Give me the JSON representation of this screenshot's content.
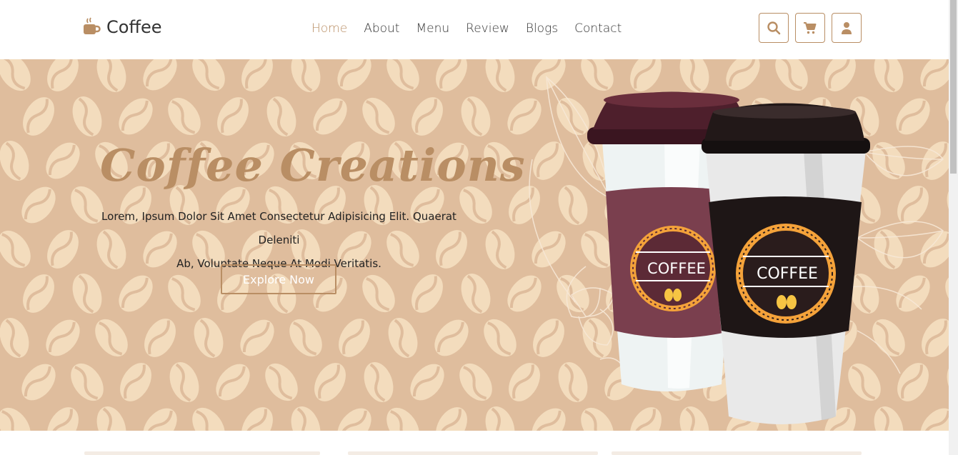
{
  "brand": {
    "logo_icon": "coffee-cup-icon",
    "name": "Coffee"
  },
  "nav": {
    "items": [
      {
        "label": "Home",
        "active": true
      },
      {
        "label": "About",
        "active": false
      },
      {
        "label": "Menu",
        "active": false
      },
      {
        "label": "Review",
        "active": false
      },
      {
        "label": "Blogs",
        "active": false
      },
      {
        "label": "Contact",
        "active": false
      }
    ]
  },
  "header_icons": [
    "search-icon",
    "cart-icon",
    "user-icon"
  ],
  "hero": {
    "title": "Coffee Creations",
    "text_line1": "Lorem, Ipsum Dolor Sit Amet Consectetur Adipisicing Elit. Quaerat Deleniti",
    "text_line2": "Ab, Voluptate Neque At Modi Veritatis.",
    "button_label": "Explore Now",
    "cup_label_1": "COFFEE",
    "cup_label_2": "COFFEE"
  },
  "colors": {
    "accent": "#b98e64",
    "hero_background": "#dfbd9d",
    "bean": "#f3dcbd",
    "dark_text": "#333333"
  }
}
